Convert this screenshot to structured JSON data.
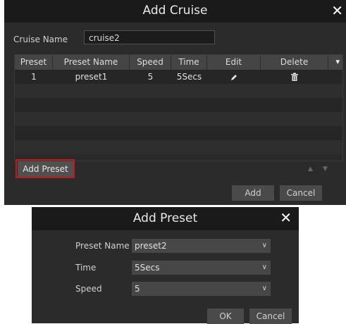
{
  "cruise_dialog": {
    "title": "Add Cruise",
    "close_icon": "close-icon",
    "cruise_name_label": "Cruise Name",
    "cruise_name_value": "cruise2",
    "columns": [
      "Preset",
      "Preset Name",
      "Speed",
      "Time",
      "Edit",
      "Delete"
    ],
    "rows": [
      {
        "preset": "1",
        "preset_name": "preset1",
        "speed": "5",
        "time": "5Secs",
        "edit_icon": "pencil-icon",
        "delete_icon": "trash-icon"
      }
    ],
    "add_preset_label": "Add Preset",
    "move_up_icon": "arrow-up-icon",
    "move_down_icon": "arrow-down-icon",
    "add_label": "Add",
    "cancel_label": "Cancel",
    "highlight_color": "#c21a1a"
  },
  "preset_dialog": {
    "title": "Add Preset",
    "close_icon": "close-icon",
    "preset_name_label": "Preset Name",
    "preset_name_value": "preset2",
    "time_label": "Time",
    "time_value": "5Secs",
    "speed_label": "Speed",
    "speed_value": "5",
    "ok_label": "OK",
    "cancel_label": "Cancel"
  }
}
